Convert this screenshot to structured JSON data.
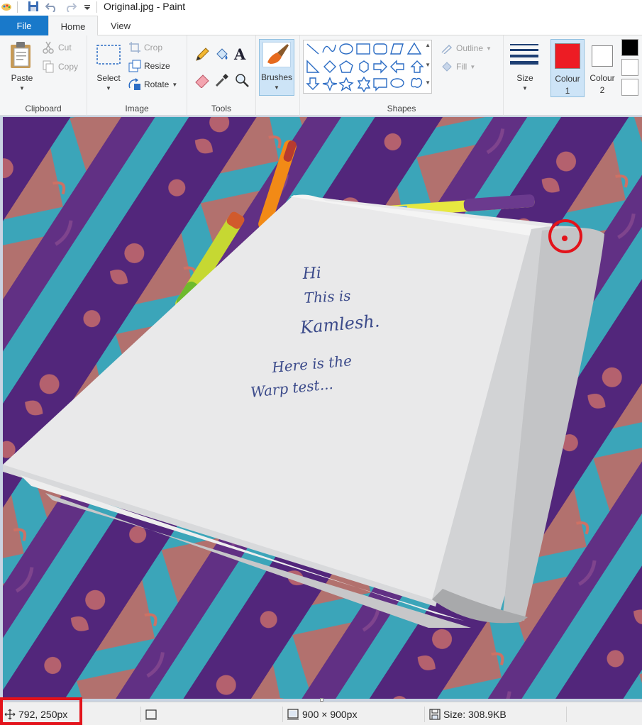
{
  "window": {
    "title": "Original.jpg - Paint"
  },
  "tabs": [
    {
      "label": "File"
    },
    {
      "label": "Home"
    },
    {
      "label": "View"
    }
  ],
  "clipboard": {
    "paste": "Paste",
    "cut": "Cut",
    "copy": "Copy",
    "group": "Clipboard"
  },
  "image": {
    "select": "Select",
    "crop": "Crop",
    "resize": "Resize",
    "rotate": "Rotate",
    "group": "Image"
  },
  "tools": {
    "group": "Tools",
    "text_glyph": "A"
  },
  "brushes": {
    "label": "Brushes"
  },
  "shapes": {
    "outline": "Outline",
    "fill": "Fill",
    "group": "Shapes"
  },
  "size": {
    "label": "Size"
  },
  "colours": {
    "colour1_line1": "Colour",
    "colour1_line2": "1",
    "colour2_line1": "Colour",
    "colour2_line2": "2",
    "colour1_value": "#ed1c24",
    "colour2_value": "#ffffff",
    "palette_first": [
      "#000000",
      "#ffffff",
      "#ffffff"
    ]
  },
  "canvas": {
    "handwriting": [
      "Hi",
      "This is",
      "Kamlesh.",
      "Here is the",
      "Warp test..."
    ]
  },
  "status": {
    "cursor_position": "792, 250px",
    "image_dimensions": "900 × 900px",
    "file_size": "Size: 308.9KB"
  }
}
